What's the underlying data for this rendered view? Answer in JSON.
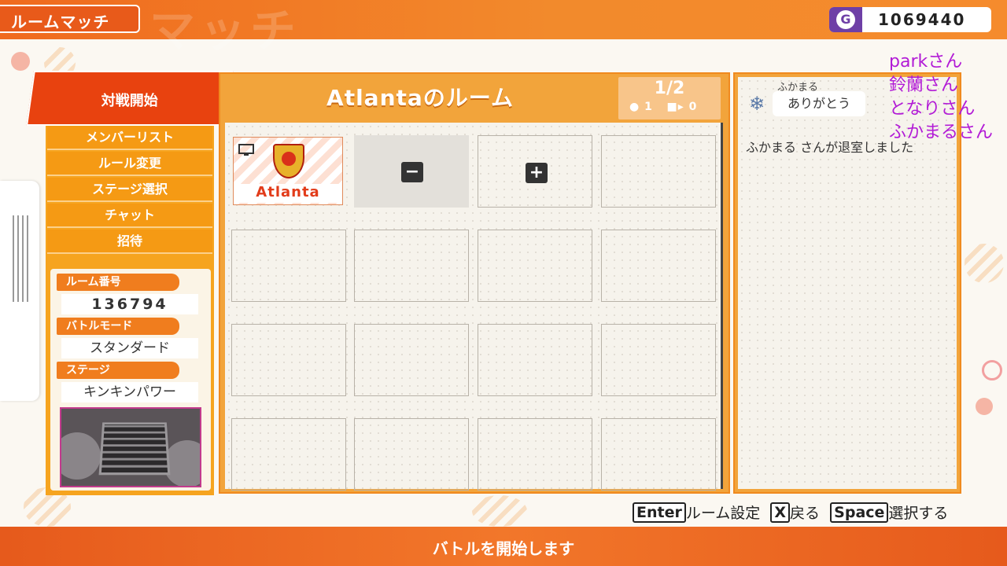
{
  "header": {
    "title": "ルームマッチ",
    "bg_text": "マッチ",
    "coins": "1069440"
  },
  "menu": {
    "start_label": "対戦開始",
    "items": [
      {
        "label": "メンバーリスト"
      },
      {
        "label": "ルール変更"
      },
      {
        "label": "ステージ選択"
      },
      {
        "label": "チャット"
      },
      {
        "label": "招待"
      }
    ]
  },
  "room_info": {
    "room_number_label": "ルーム番号",
    "room_number": "136794",
    "battle_mode_label": "バトルモード",
    "battle_mode": "スタンダード",
    "stage_label": "ステージ",
    "stage": "キンキンパワー"
  },
  "room": {
    "title": "Atlantaのルーム",
    "player_count": "1/2",
    "player_sub": "1",
    "spectator_sub": "0",
    "players": [
      {
        "name": "Atlanta"
      }
    ],
    "slot_minus": "−",
    "slot_plus": "+"
  },
  "chat": {
    "sender": "ふかまる",
    "message": "ありがとう",
    "system_message": "ふかまる さんが退室しました"
  },
  "overlay_names": [
    "parkさん",
    "鈴蘭さん",
    "となりさん",
    "ふかまるさん"
  ],
  "hints": {
    "enter_key": "Enter",
    "enter_text": "ルーム設定",
    "x_key": "X",
    "x_text": "戻る",
    "space_key": "Space",
    "space_text": "選択する"
  },
  "footer": {
    "text": "バトルを開始します"
  },
  "colors": {
    "accent_orange": "#f2a43b",
    "header_orange": "#f06a1e",
    "start_red": "#e8420f",
    "overlay_purple": "#b21bd6",
    "coin_purple": "#6e3fa6"
  }
}
